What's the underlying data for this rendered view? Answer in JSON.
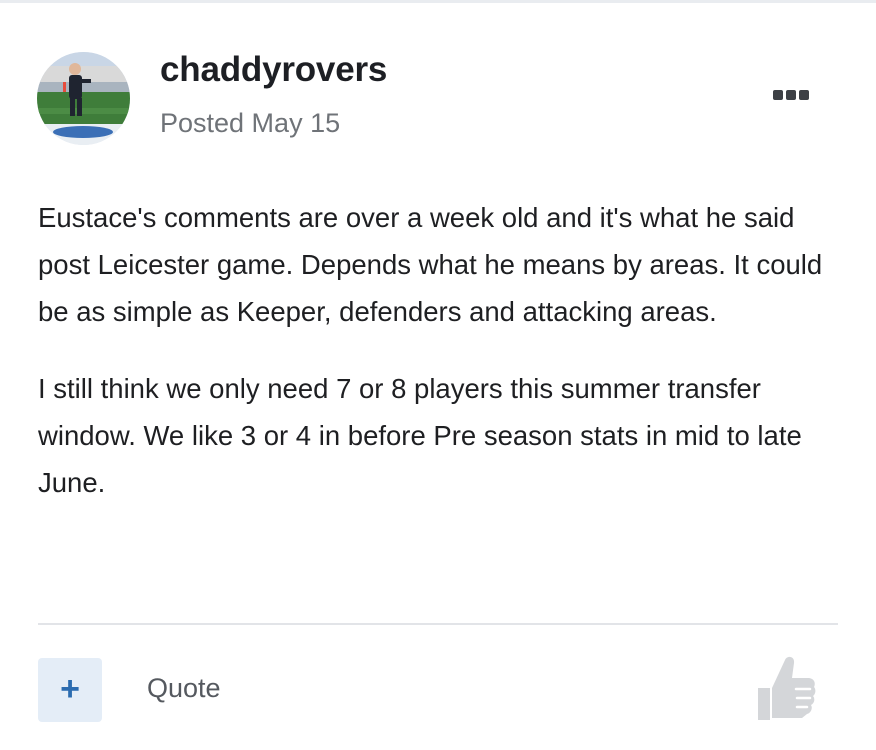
{
  "author": {
    "username": "chaddyrovers",
    "posted": "Posted May 15"
  },
  "post": {
    "paragraphs": [
      "Eustace's comments are over a week old and it's what he said post Leicester game. Depends what he means by areas. It could be as simple as Keeper, defenders and attacking areas.",
      "I still think we only need 7 or 8 players this summer transfer window. We like 3 or 4 in before Pre season stats in mid to late June."
    ]
  },
  "actions": {
    "multiquote_label": "+",
    "quote_label": "Quote"
  },
  "icons": {
    "more": "more-options-icon",
    "like": "thumbs-up-icon"
  },
  "colors": {
    "accent": "#2b6cb0",
    "multiquote_bg": "#e4edf7",
    "meta_text": "#6f7378"
  }
}
